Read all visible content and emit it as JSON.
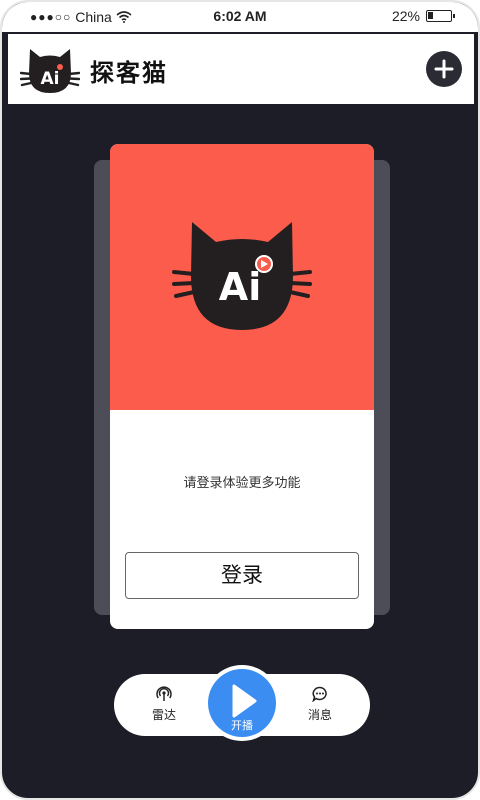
{
  "status_bar": {
    "carrier": "China",
    "time": "6:02 AM",
    "battery": "22%",
    "battery_level": 0.22
  },
  "header": {
    "title": "探客猫",
    "logo_text": "Ai",
    "add_icon": "plus-icon"
  },
  "card": {
    "logo_text": "Ai",
    "prompt": "请登录体验更多功能",
    "login_label": "登录"
  },
  "tabbar": {
    "radar_label": "雷达",
    "play_label": "开播",
    "messages_label": "消息",
    "icons": [
      "radar-icon",
      "play-icon",
      "chat-icon"
    ]
  },
  "colors": {
    "background": "#1d1d27",
    "hero": "#fb5c4b",
    "play_button": "#3b8df1",
    "header_add": "#2b2b34"
  }
}
